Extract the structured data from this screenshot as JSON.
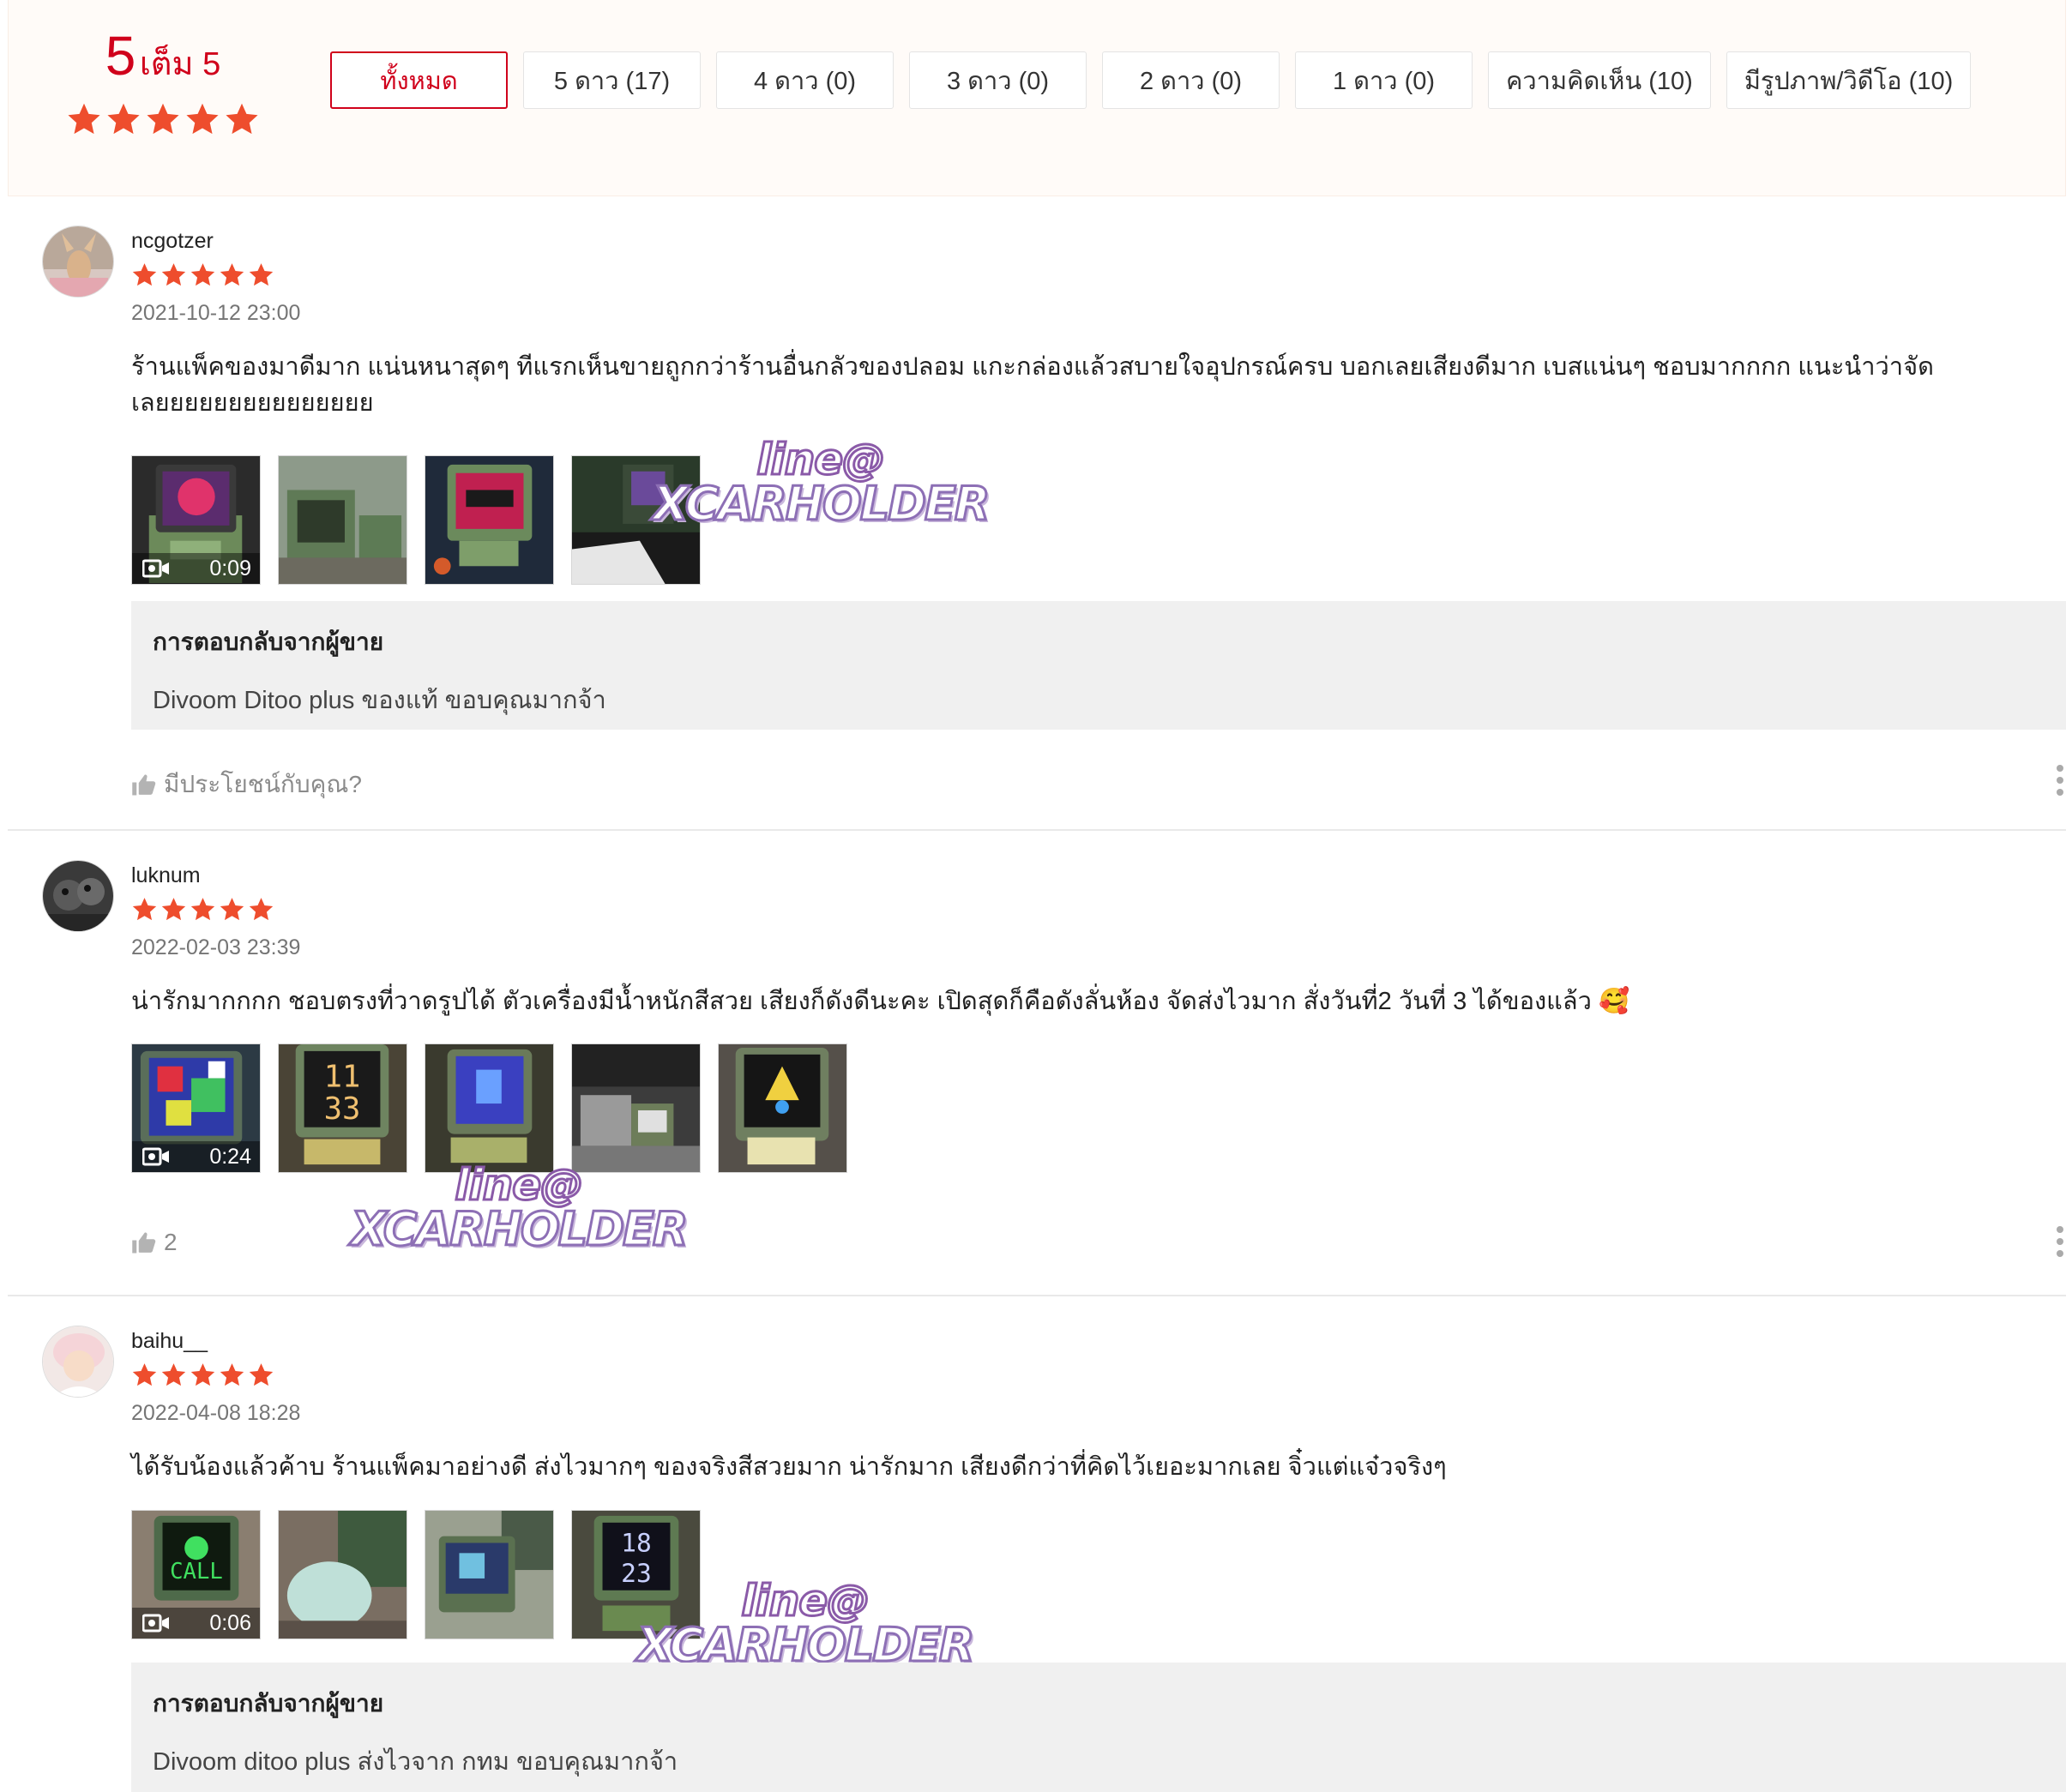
{
  "summary": {
    "score": "5",
    "score_suffix": "เต็ม 5",
    "rating": 5,
    "filters": [
      {
        "label": "ทั้งหมด",
        "active": true
      },
      {
        "label": "5 ดาว (17)",
        "active": false
      },
      {
        "label": "4 ดาว (0)",
        "active": false
      },
      {
        "label": "3 ดาว (0)",
        "active": false
      },
      {
        "label": "2 ดาว (0)",
        "active": false
      },
      {
        "label": "1 ดาว (0)",
        "active": false
      },
      {
        "label": "ความคิดเห็น (10)",
        "active": false
      },
      {
        "label": "มีรูปภาพ/วิดีโอ (10)",
        "active": false
      }
    ]
  },
  "colors": {
    "accent": "#d0011b",
    "star": "#ee4d2d",
    "summary_bg": "#fffbf8",
    "reply_bg": "#f0f0f0"
  },
  "watermark": {
    "top": "line@",
    "bottom": "XCARHOLDER"
  },
  "reviews": [
    {
      "username": "ncgotzer",
      "rating": 5,
      "date": "2021-10-12 23:00",
      "comment": "ร้านแพ็คของมาดีมาก แน่นหนาสุดๆ ทีแรกเห็นขายถูกกว่าร้านอื่นกลัวของปลอม แกะกล่องแล้วสบายใจอุปกรณ์ครบ บอกเลยเสียงดีมาก เบสแน่นๆ ชอบมากกกก แนะนำว่าจัดเลยยยยยยยยยยยยยยย",
      "video_duration": "0:09",
      "reply_title": "การตอบกลับจากผู้ขาย",
      "reply_text": "Divoom Ditoo plus ของแท้ ขอบคุณมากจ้า",
      "helpful_text": "มีประโยชน์กับคุณ?"
    },
    {
      "username": "luknum",
      "rating": 5,
      "date": "2022-02-03 23:39",
      "comment": "น่ารักมากกกก ชอบตรงที่วาดรูปได้ ตัวเครื่องมีน้ำหนักสีสวย เสียงก็ดังดีนะคะ เปิดสุดก็คือดังลั่นห้อง จัดส่งไวมาก สั่งวันที่2 วันที่ 3 ได้ของแล้ว 🥰",
      "video_duration": "0:24",
      "helpful_text": "2"
    },
    {
      "username": "baihu__",
      "rating": 5,
      "date": "2022-04-08 18:28",
      "comment": "ได้รับน้องแล้วค้าบ ร้านแพ็คมาอย่างดี ส่งไวมากๆ ของจริงสีสวยมาก น่ารักมาก เสียงดีกว่าที่คิดไว้เยอะมากเลย จิ๋วแต่แจ๋วจริงๆ",
      "video_duration": "0:06",
      "reply_title": "การตอบกลับจากผู้ขาย",
      "reply_text": "Divoom ditoo plus ส่งไวจาก กทม ขอบคุณมากจ้า"
    }
  ]
}
